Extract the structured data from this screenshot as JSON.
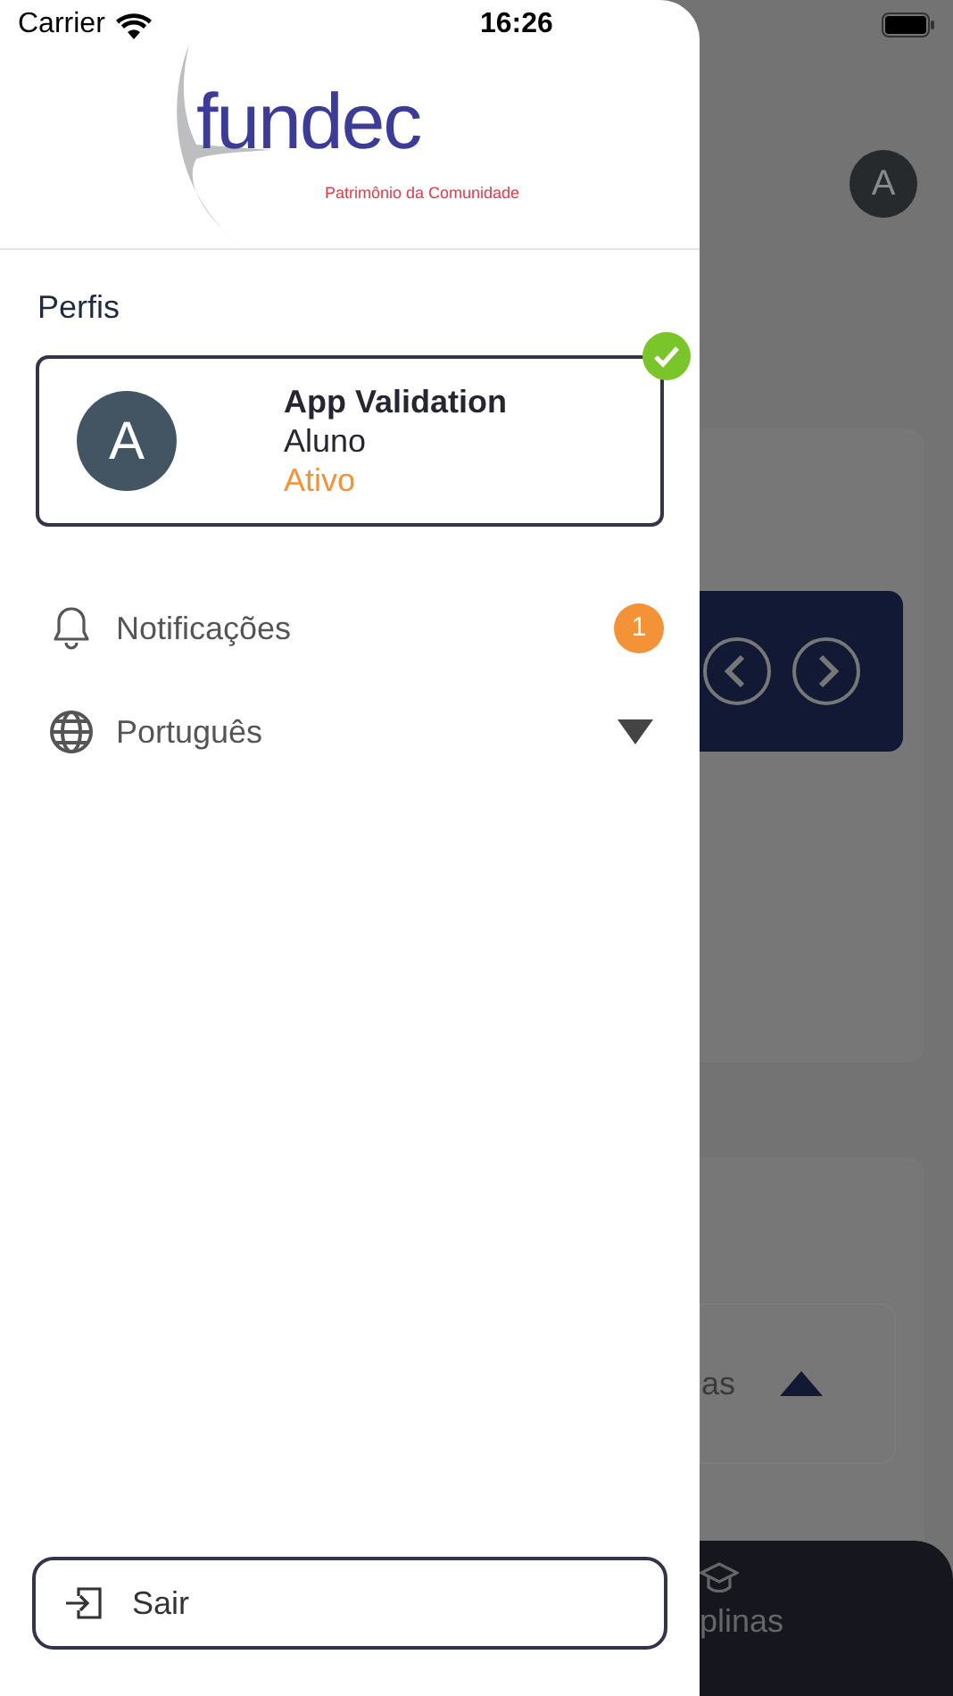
{
  "status_bar": {
    "carrier": "Carrier",
    "time": "16:26"
  },
  "logo": {
    "name": "fundec",
    "tagline": "Patrimônio da Comunidade"
  },
  "drawer": {
    "section_title": "Perfis",
    "profiles": [
      {
        "initial": "A",
        "name": "App Validation",
        "role": "Aluno",
        "status": "Ativo",
        "selected": true
      }
    ],
    "menu": [
      {
        "kind": "notifications",
        "label": "Notificações",
        "badge": "1"
      },
      {
        "kind": "language",
        "label": "Português",
        "expanded": false
      }
    ],
    "logout": "Sair"
  },
  "background": {
    "avatar": "A",
    "section_label": "as",
    "tab_label": "plinas"
  }
}
